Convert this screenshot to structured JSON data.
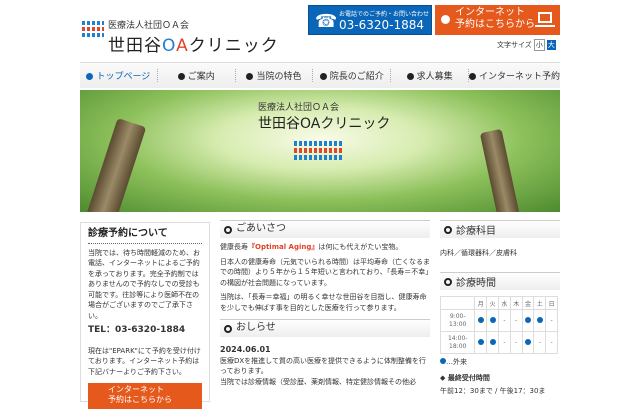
{
  "header": {
    "org": "医療法人社団ＯＡ会",
    "clinic_pre": "世田谷",
    "clinic_o": "O",
    "clinic_a": "A",
    "clinic_post": "クリニック",
    "tel_caption": "お電話でのご予約・お問い合わせ",
    "tel": "03-6320-1884",
    "web_line1": "インターネット",
    "web_line2": "予約はこちらから",
    "font_size_label": "文字サイズ",
    "font_small": "小",
    "font_large": "大"
  },
  "nav": [
    "トップページ",
    "ご案内",
    "当院の特色",
    "院長のご紹介",
    "求人募集",
    "インターネット予約"
  ],
  "hero": {
    "org": "医療法人社団ＯＡ会",
    "clinic": "世田谷OAクリニック"
  },
  "sidebar": {
    "title": "診療予約について",
    "text": "当院では、待ち時間軽減のため、お電話、インターネットによるご予約を承っております。完全予約制ではありませんので予約なしでの受診も可能です。往診等により医師不在の場合がございますのでご了承下さい。",
    "tel": "TEL：03-6320-1884",
    "text2": "現在は\"EPARK\"にて予約を受け付けております。インターネット予約は下記バナーよりご予約下さい。",
    "btn1": "インターネット",
    "btn2": "予約はこちらから"
  },
  "greeting": {
    "title": "ごあいさつ",
    "p1a": "健康長寿",
    "p1b": "『Optimal Aging』",
    "p1c": "は何にも代えがたい宝物。",
    "p2": "日本人の健康寿命（元気でいられる時間）は平均寿命（亡くなるまでの時間）より５年から１５年短いと言われており、「長寿＝不幸」の構図が社会問題になっています。",
    "p3": "当院は、「長寿＝幸福」の明るく幸せな世田谷を目指し、健康寿命を少しでも伸ばす事を目的とした医療を行って参ります。"
  },
  "news": {
    "title": "おしらせ",
    "date": "2024.06.01",
    "text": "医療DXを推進して質の高い医療を提供できるように体制整備を行っております。",
    "text2": "当院では診療情報（受診歴、薬剤情報、特定健診情報その他必"
  },
  "departments": {
    "title": "診療科目",
    "text": "内科／循環器科／皮膚科"
  },
  "hours": {
    "title": "診療時間",
    "days": [
      "月",
      "火",
      "水",
      "木",
      "金",
      "土",
      "日"
    ],
    "rows": [
      {
        "time1": "9:00-",
        "time2": "13:00",
        "open": [
          1,
          1,
          0,
          0,
          1,
          1,
          0
        ]
      },
      {
        "time1": "14:00-",
        "time2": "18:00",
        "open": [
          1,
          1,
          0,
          0,
          1,
          0,
          0
        ]
      }
    ],
    "legend": "…外来",
    "last_title": "最終受付時間",
    "last": "午前12：30まで / 午後17：30ま"
  },
  "colors": {
    "blue": "#0a66b8",
    "orange": "#e55a1c"
  }
}
